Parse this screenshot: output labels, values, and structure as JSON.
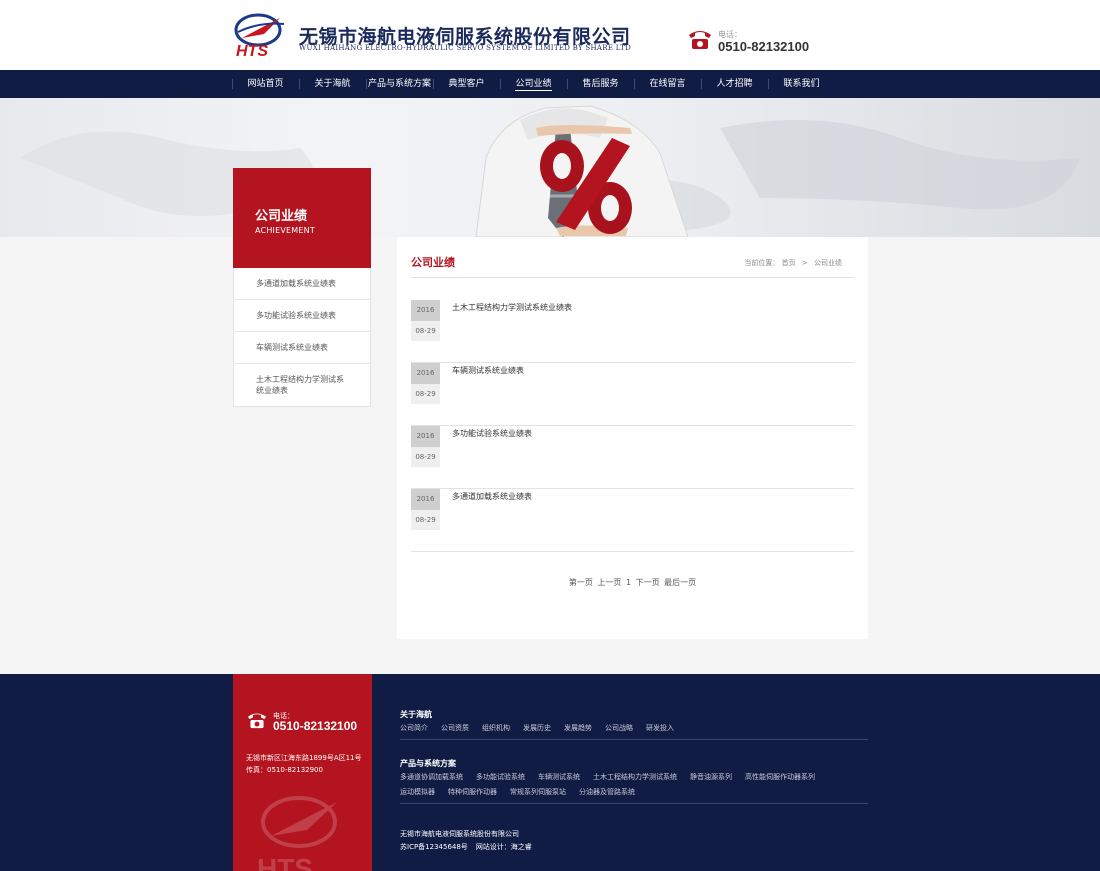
{
  "header": {
    "logo_text": "HTS",
    "company_cn": "无锡市海航电液伺服系统股份有限公司",
    "company_en": "WUXI HAIHANG ELECTRO-HYDRAULIC SERVO SYSTEM OF LIMITED BY SHARE LTD",
    "phone_label": "电话：",
    "phone_number": "0510-82132100"
  },
  "nav": {
    "items": [
      "网站首页",
      "关于海航",
      "产品与系统方案",
      "典型客户",
      "公司业绩",
      "售后服务",
      "在线留言",
      "人才招聘",
      "联系我们"
    ],
    "active": "公司业绩"
  },
  "sidebar": {
    "title_cn": "公司业绩",
    "title_en": "ACHIEVEMENT",
    "items": [
      "多通道加载系统业绩表",
      "多功能试验系统业绩表",
      "车辆测试系统业绩表",
      "土木工程结构力学测试系统业绩表"
    ]
  },
  "main": {
    "title": "公司业绩",
    "breadcrumb": {
      "label": "当前位置：",
      "home": "首页",
      "sep": ">",
      "current": "公司业绩"
    },
    "news": [
      {
        "year": "2016",
        "md": "08-29",
        "title": "土木工程结构力学测试系统业绩表"
      },
      {
        "year": "2016",
        "md": "08-29",
        "title": "车辆测试系统业绩表"
      },
      {
        "year": "2016",
        "md": "08-29",
        "title": "多功能试验系统业绩表"
      },
      {
        "year": "2016",
        "md": "08-29",
        "title": "多通道加载系统业绩表"
      }
    ],
    "pager": {
      "first": "第一页",
      "prev": "上一页",
      "current": "1",
      "next": "下一页",
      "last": "最后一页"
    }
  },
  "footer": {
    "phone_label": "电话：",
    "phone_number": "0510-82132100",
    "address": "无锡市新区江海东路1899号A区11号",
    "fax": "传真：0510-82132900",
    "about_title": "关于海航",
    "about_links": [
      "公司简介",
      "公司资质",
      "组织机构",
      "发展历史",
      "发展趋势",
      "公司战略",
      "研发投入"
    ],
    "products_title": "产品与系统方案",
    "product_links": [
      "多通道协调加载系统",
      "多功能试验系统",
      "车辆测试系统",
      "土木工程结构力学测试系统",
      "静音油源系列",
      "高性能伺服作动器系列",
      "运动模拟器",
      "特种伺服作动器",
      "常规系列伺服泵站",
      "分油器及管路系统"
    ],
    "company": "无锡市海航电液伺服系统股份有限公司",
    "icp": "苏ICP备12345648号",
    "design": "网站设计：海之睿",
    "watermark_text": "HTS"
  },
  "colors": {
    "brand_red": "#b3141f",
    "brand_navy": "#111c45"
  }
}
